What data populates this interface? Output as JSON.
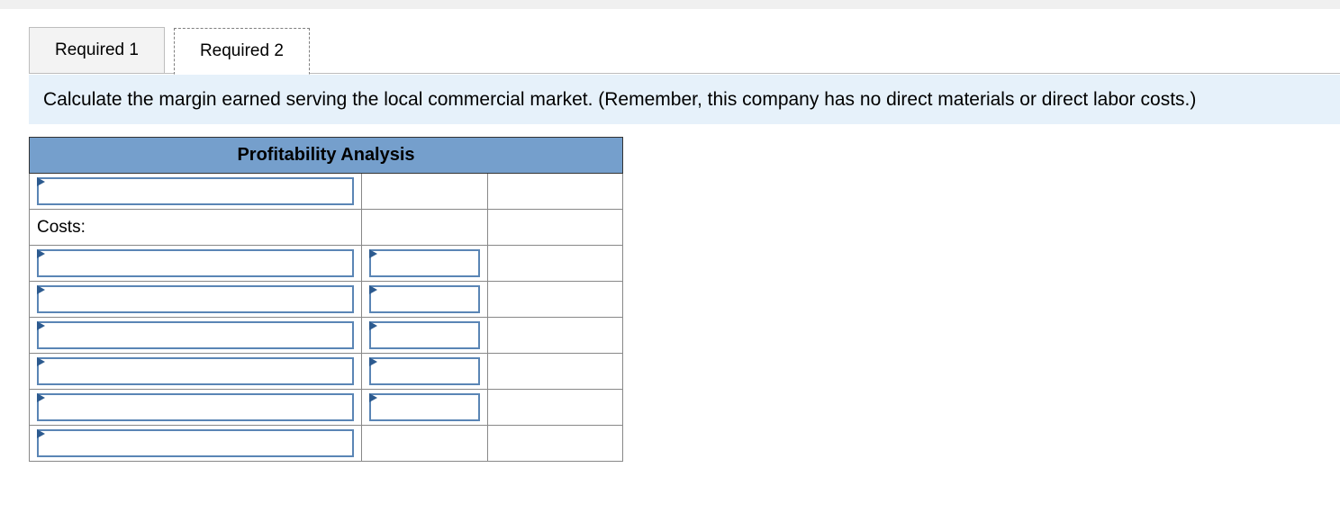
{
  "tabs": {
    "t1": "Required 1",
    "t2": "Required 2"
  },
  "instructions": "Calculate the margin earned serving the local commercial market. (Remember, this company has no direct materials or direct labor costs.)",
  "worksheet": {
    "title": "Profitability Analysis",
    "rows": {
      "costs_label": "Costs:"
    }
  }
}
